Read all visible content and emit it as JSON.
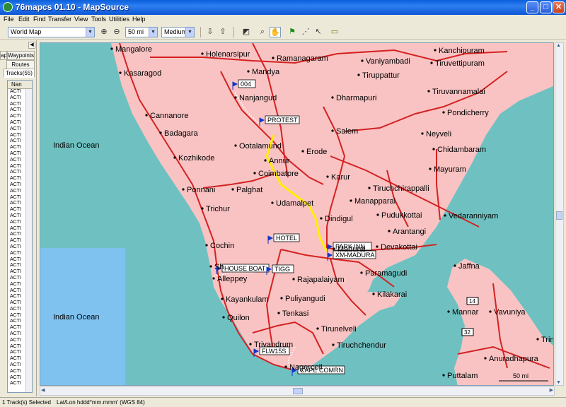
{
  "window": {
    "title": "76mapcs 01.10 - MapSource",
    "min": "_",
    "max": "□",
    "close": "✕"
  },
  "menu": [
    "File",
    "Edit",
    "Find",
    "Transfer",
    "View",
    "Tools",
    "Utilities",
    "Help"
  ],
  "toolbar": {
    "product": "World Map",
    "zoom": "50 mi",
    "detail": "Medium"
  },
  "left_panel": {
    "tabs": {
      "waypoints": "Waypoints(",
      "routes": "Routes",
      "tracks": "Tracks(55)",
      "cut": "apb"
    },
    "list_header": "Nan",
    "rows": [
      "ACTI",
      "ACTI",
      "ACTI",
      "ACTI",
      "ACTI",
      "ACTI",
      "ACTI",
      "ACTI",
      "ACTI",
      "ACTI",
      "ACTI",
      "ACTI",
      "ACTI",
      "ACTI",
      "ACTI",
      "ACTI",
      "ACTI",
      "ACTI",
      "ACTI",
      "ACTI",
      "ACTI",
      "ACTI",
      "ACTI",
      "ACTI",
      "ACTI",
      "ACTI",
      "ACTI",
      "ACTI",
      "ACTI",
      "ACTI",
      "ACTI",
      "ACTI",
      "ACTI",
      "ACTI",
      "ACTI",
      "ACTI",
      "ACTI",
      "ACTI",
      "ACTI",
      "ACTI",
      "ACTI",
      "ACTI",
      "ACTI",
      "ACTI",
      "ACTI",
      "ACTI",
      "ACTI",
      "ACTI"
    ]
  },
  "map": {
    "colors": {
      "land": "#f9c3c3",
      "sea": "#6fc1c1",
      "ocean": "#7fc2f0",
      "road": "#d42222",
      "track": "#ffee00"
    },
    "ocean_labels": [
      "Indian Ocean",
      "Indian Ocean",
      "Indian Ocean"
    ],
    "cities": [
      "Mangalore",
      "Holenarsipur",
      "Ramanagaram",
      "Kanchipuram",
      "Kasaragod",
      "Mandya",
      "Vaniyambadi",
      "Tiruvettipuram",
      "Tiruppattur",
      "Nanjangud",
      "Dharmapuri",
      "Tiruvannamalai",
      "Cannanore",
      "Pondicherry",
      "Badagara",
      "Salem",
      "Neyveli",
      "Ootalamund",
      "Erode",
      "Chidambaram",
      "Kozhikode",
      "Annur",
      "Coimbatore",
      "Karur",
      "Mayuram",
      "Ponnani",
      "Palghat",
      "Tiruchchirappalli",
      "Udamalpet",
      "Manapparai",
      "Trichur",
      "Dindigul",
      "Pudukkottai",
      "Vedaranniyam",
      "Arantangi",
      "Cochin",
      "Devakottai",
      "Jaffna",
      "Paramagudi",
      "Alleppey",
      "Rajapalaiyam",
      "Kilakarai",
      "Kayankulam",
      "Puliyangudi",
      "Mannar",
      "Tenkasi",
      "Quilon",
      "Vavuniya",
      "Tirunelveli",
      "Tiruchchendur",
      "Trivandrum",
      "Trin",
      "Anuradhapura",
      "Puttalam",
      "Sh",
      "Madurai",
      "Nagercoil"
    ],
    "waypoints": [
      "004",
      "PROTEST",
      "HOTEL",
      "PARK INN",
      "XM-MADURA",
      "HOUSE BOAT",
      "TIGG",
      "FLW15S",
      "CAPE COMRN"
    ],
    "highways": [
      "14",
      "32"
    ],
    "scale": "50 mi"
  },
  "status": {
    "left": "1 Track(s) Selected",
    "right": "Lat/Lon hddd°mm.mmm' (WGS 84)"
  }
}
